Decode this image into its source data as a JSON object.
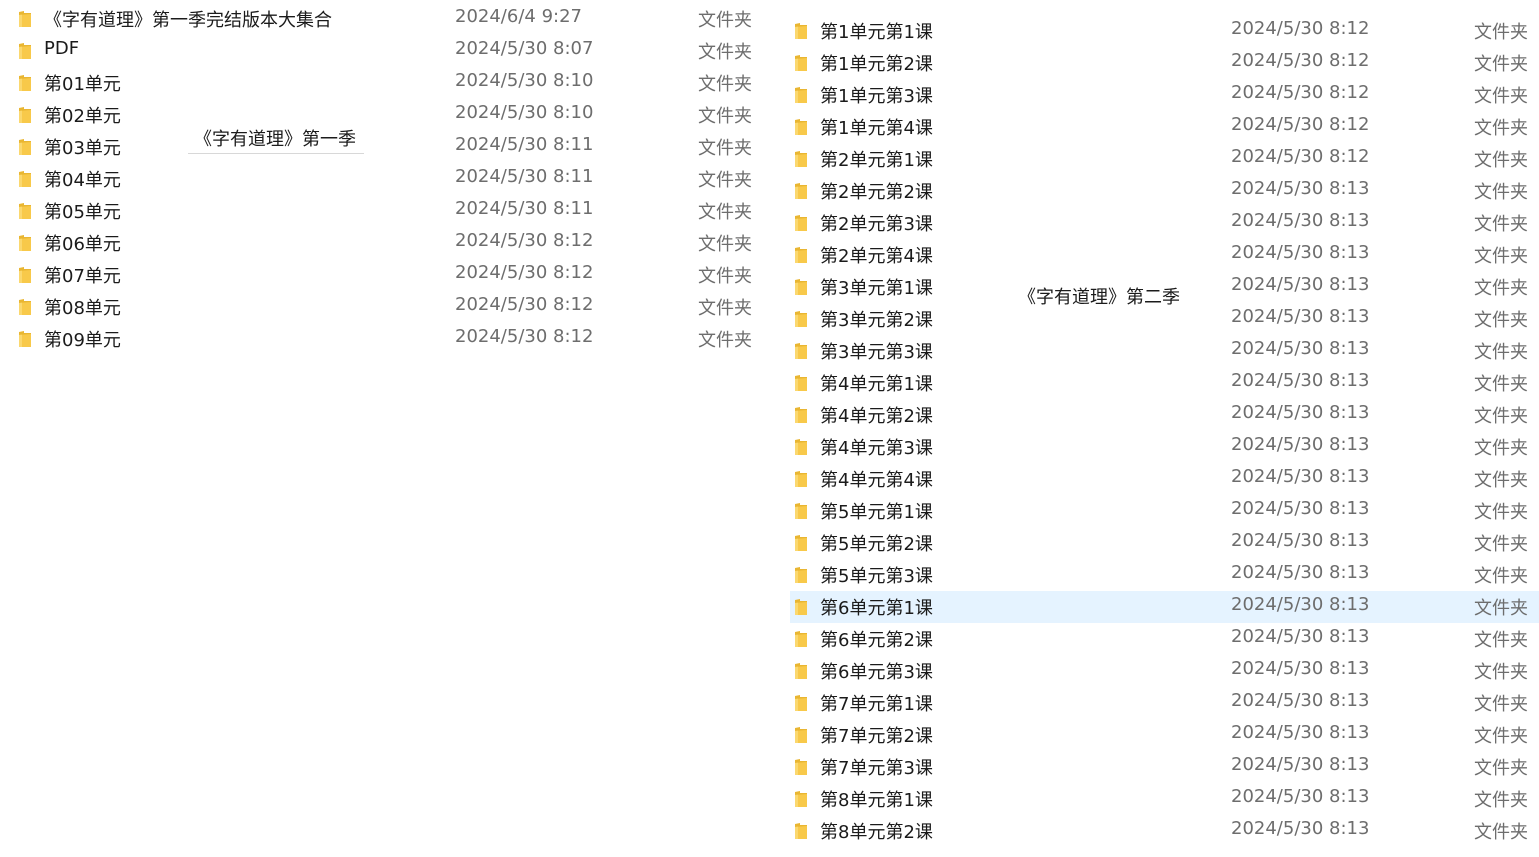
{
  "season1": {
    "label": "《字有道理》第一季",
    "items": [
      {
        "name": "《字有道理》第一季完结版本大集合",
        "date": "2024/6/4 9:27",
        "type": "文件夹"
      },
      {
        "name": "PDF",
        "date": "2024/5/30 8:07",
        "type": "文件夹"
      },
      {
        "name": "第01单元",
        "date": "2024/5/30 8:10",
        "type": "文件夹"
      },
      {
        "name": "第02单元",
        "date": "2024/5/30 8:10",
        "type": "文件夹"
      },
      {
        "name": "第03单元",
        "date": "2024/5/30 8:11",
        "type": "文件夹"
      },
      {
        "name": "第04单元",
        "date": "2024/5/30 8:11",
        "type": "文件夹"
      },
      {
        "name": "第05单元",
        "date": "2024/5/30 8:11",
        "type": "文件夹"
      },
      {
        "name": "第06单元",
        "date": "2024/5/30 8:12",
        "type": "文件夹"
      },
      {
        "name": "第07单元",
        "date": "2024/5/30 8:12",
        "type": "文件夹"
      },
      {
        "name": "第08单元",
        "date": "2024/5/30 8:12",
        "type": "文件夹"
      },
      {
        "name": "第09单元",
        "date": "2024/5/30 8:12",
        "type": "文件夹"
      }
    ]
  },
  "season2": {
    "label": "《字有道理》第二季",
    "selected_index": 18,
    "items": [
      {
        "name": "第1单元第1课",
        "date": "2024/5/30 8:12",
        "type": "文件夹"
      },
      {
        "name": "第1单元第2课",
        "date": "2024/5/30 8:12",
        "type": "文件夹"
      },
      {
        "name": "第1单元第3课",
        "date": "2024/5/30 8:12",
        "type": "文件夹"
      },
      {
        "name": "第1单元第4课",
        "date": "2024/5/30 8:12",
        "type": "文件夹"
      },
      {
        "name": "第2单元第1课",
        "date": "2024/5/30 8:12",
        "type": "文件夹"
      },
      {
        "name": "第2单元第2课",
        "date": "2024/5/30 8:13",
        "type": "文件夹"
      },
      {
        "name": "第2单元第3课",
        "date": "2024/5/30 8:13",
        "type": "文件夹"
      },
      {
        "name": "第2单元第4课",
        "date": "2024/5/30 8:13",
        "type": "文件夹"
      },
      {
        "name": "第3单元第1课",
        "date": "2024/5/30 8:13",
        "type": "文件夹"
      },
      {
        "name": "第3单元第2课",
        "date": "2024/5/30 8:13",
        "type": "文件夹"
      },
      {
        "name": "第3单元第3课",
        "date": "2024/5/30 8:13",
        "type": "文件夹"
      },
      {
        "name": "第4单元第1课",
        "date": "2024/5/30 8:13",
        "type": "文件夹"
      },
      {
        "name": "第4单元第2课",
        "date": "2024/5/30 8:13",
        "type": "文件夹"
      },
      {
        "name": "第4单元第3课",
        "date": "2024/5/30 8:13",
        "type": "文件夹"
      },
      {
        "name": "第4单元第4课",
        "date": "2024/5/30 8:13",
        "type": "文件夹"
      },
      {
        "name": "第5单元第1课",
        "date": "2024/5/30 8:13",
        "type": "文件夹"
      },
      {
        "name": "第5单元第2课",
        "date": "2024/5/30 8:13",
        "type": "文件夹"
      },
      {
        "name": "第5单元第3课",
        "date": "2024/5/30 8:13",
        "type": "文件夹"
      },
      {
        "name": "第6单元第1课",
        "date": "2024/5/30 8:13",
        "type": "文件夹"
      },
      {
        "name": "第6单元第2课",
        "date": "2024/5/30 8:13",
        "type": "文件夹"
      },
      {
        "name": "第6单元第3课",
        "date": "2024/5/30 8:13",
        "type": "文件夹"
      },
      {
        "name": "第7单元第1课",
        "date": "2024/5/30 8:13",
        "type": "文件夹"
      },
      {
        "name": "第7单元第2课",
        "date": "2024/5/30 8:13",
        "type": "文件夹"
      },
      {
        "name": "第7单元第3课",
        "date": "2024/5/30 8:13",
        "type": "文件夹"
      },
      {
        "name": "第8单元第1课",
        "date": "2024/5/30 8:13",
        "type": "文件夹"
      },
      {
        "name": "第8单元第2课",
        "date": "2024/5/30 8:13",
        "type": "文件夹"
      }
    ]
  },
  "colors": {
    "folder_yellow": "#f8c94a",
    "selection": "#e5f3ff"
  },
  "icons": {
    "folder": "folder-icon"
  }
}
